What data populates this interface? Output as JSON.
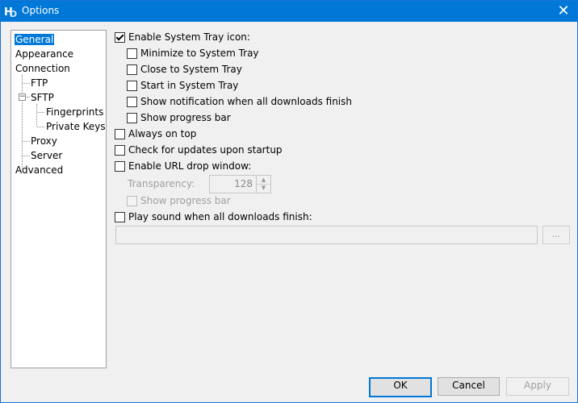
{
  "window": {
    "title": "Options"
  },
  "tree": {
    "items": [
      {
        "label": "General",
        "selected": true
      },
      {
        "label": "Appearance"
      },
      {
        "label": "Connection"
      },
      {
        "label": "FTP"
      },
      {
        "label": "SFTP"
      },
      {
        "label": "Fingerprints"
      },
      {
        "label": "Private Keys"
      },
      {
        "label": "Proxy"
      },
      {
        "label": "Server"
      },
      {
        "label": "Advanced"
      }
    ]
  },
  "options": {
    "tray": {
      "label": "Enable System Tray icon:",
      "checked": true
    },
    "minimize_tray": {
      "label": "Minimize to System Tray",
      "checked": false
    },
    "close_tray": {
      "label": "Close to System Tray",
      "checked": false
    },
    "start_tray": {
      "label": "Start in System Tray",
      "checked": false
    },
    "notify": {
      "label": "Show notification when all downloads finish",
      "checked": false
    },
    "tray_progress": {
      "label": "Show progress bar",
      "checked": false
    },
    "always_top": {
      "label": "Always on top",
      "checked": false
    },
    "check_updates": {
      "label": "Check for updates upon startup",
      "checked": false
    },
    "url_drop": {
      "label": "Enable URL drop window:",
      "checked": false
    },
    "transparency": {
      "label": "Transparency:",
      "value": "128"
    },
    "drop_progress": {
      "label": "Show progress bar",
      "checked": false
    },
    "play_sound": {
      "label": "Play sound when all downloads finish:",
      "checked": false
    },
    "sound_path": {
      "value": ""
    },
    "browse_label": "..."
  },
  "buttons": {
    "ok": "OK",
    "cancel": "Cancel",
    "apply": "Apply"
  },
  "colors": {
    "titlebar": "#0078d7",
    "selection": "#0078d7"
  }
}
